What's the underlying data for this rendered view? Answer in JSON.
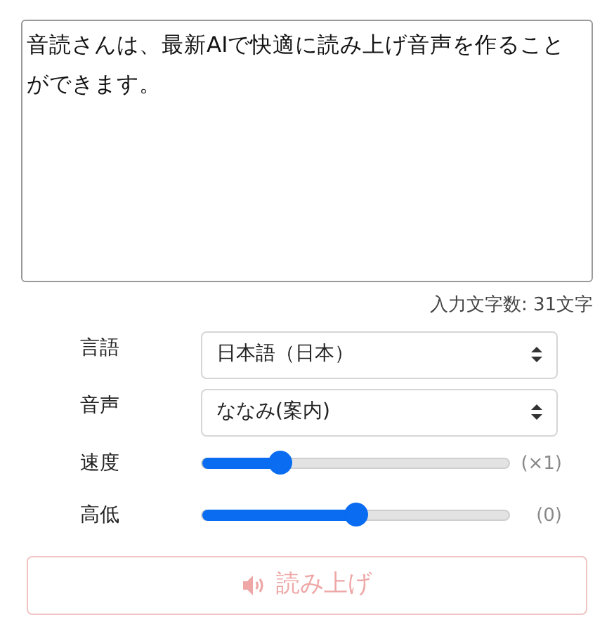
{
  "text_input": {
    "value": "音読さんは、最新AIで快適に読み上げ音声を作ることができます。"
  },
  "char_count": "入力文字数: 31文字",
  "settings": [
    {
      "kind": "select",
      "label": "言語",
      "value": "日本語（日本）"
    },
    {
      "kind": "select",
      "label": "音声",
      "value": "ななみ(案内)"
    },
    {
      "kind": "slider",
      "label": "速度",
      "level": 0.25,
      "reading": "(×1)"
    },
    {
      "kind": "slider",
      "label": "高低",
      "level": 0.5,
      "reading": "(0)"
    }
  ],
  "read_button": {
    "label": "読み上げ",
    "disabled": true
  }
}
